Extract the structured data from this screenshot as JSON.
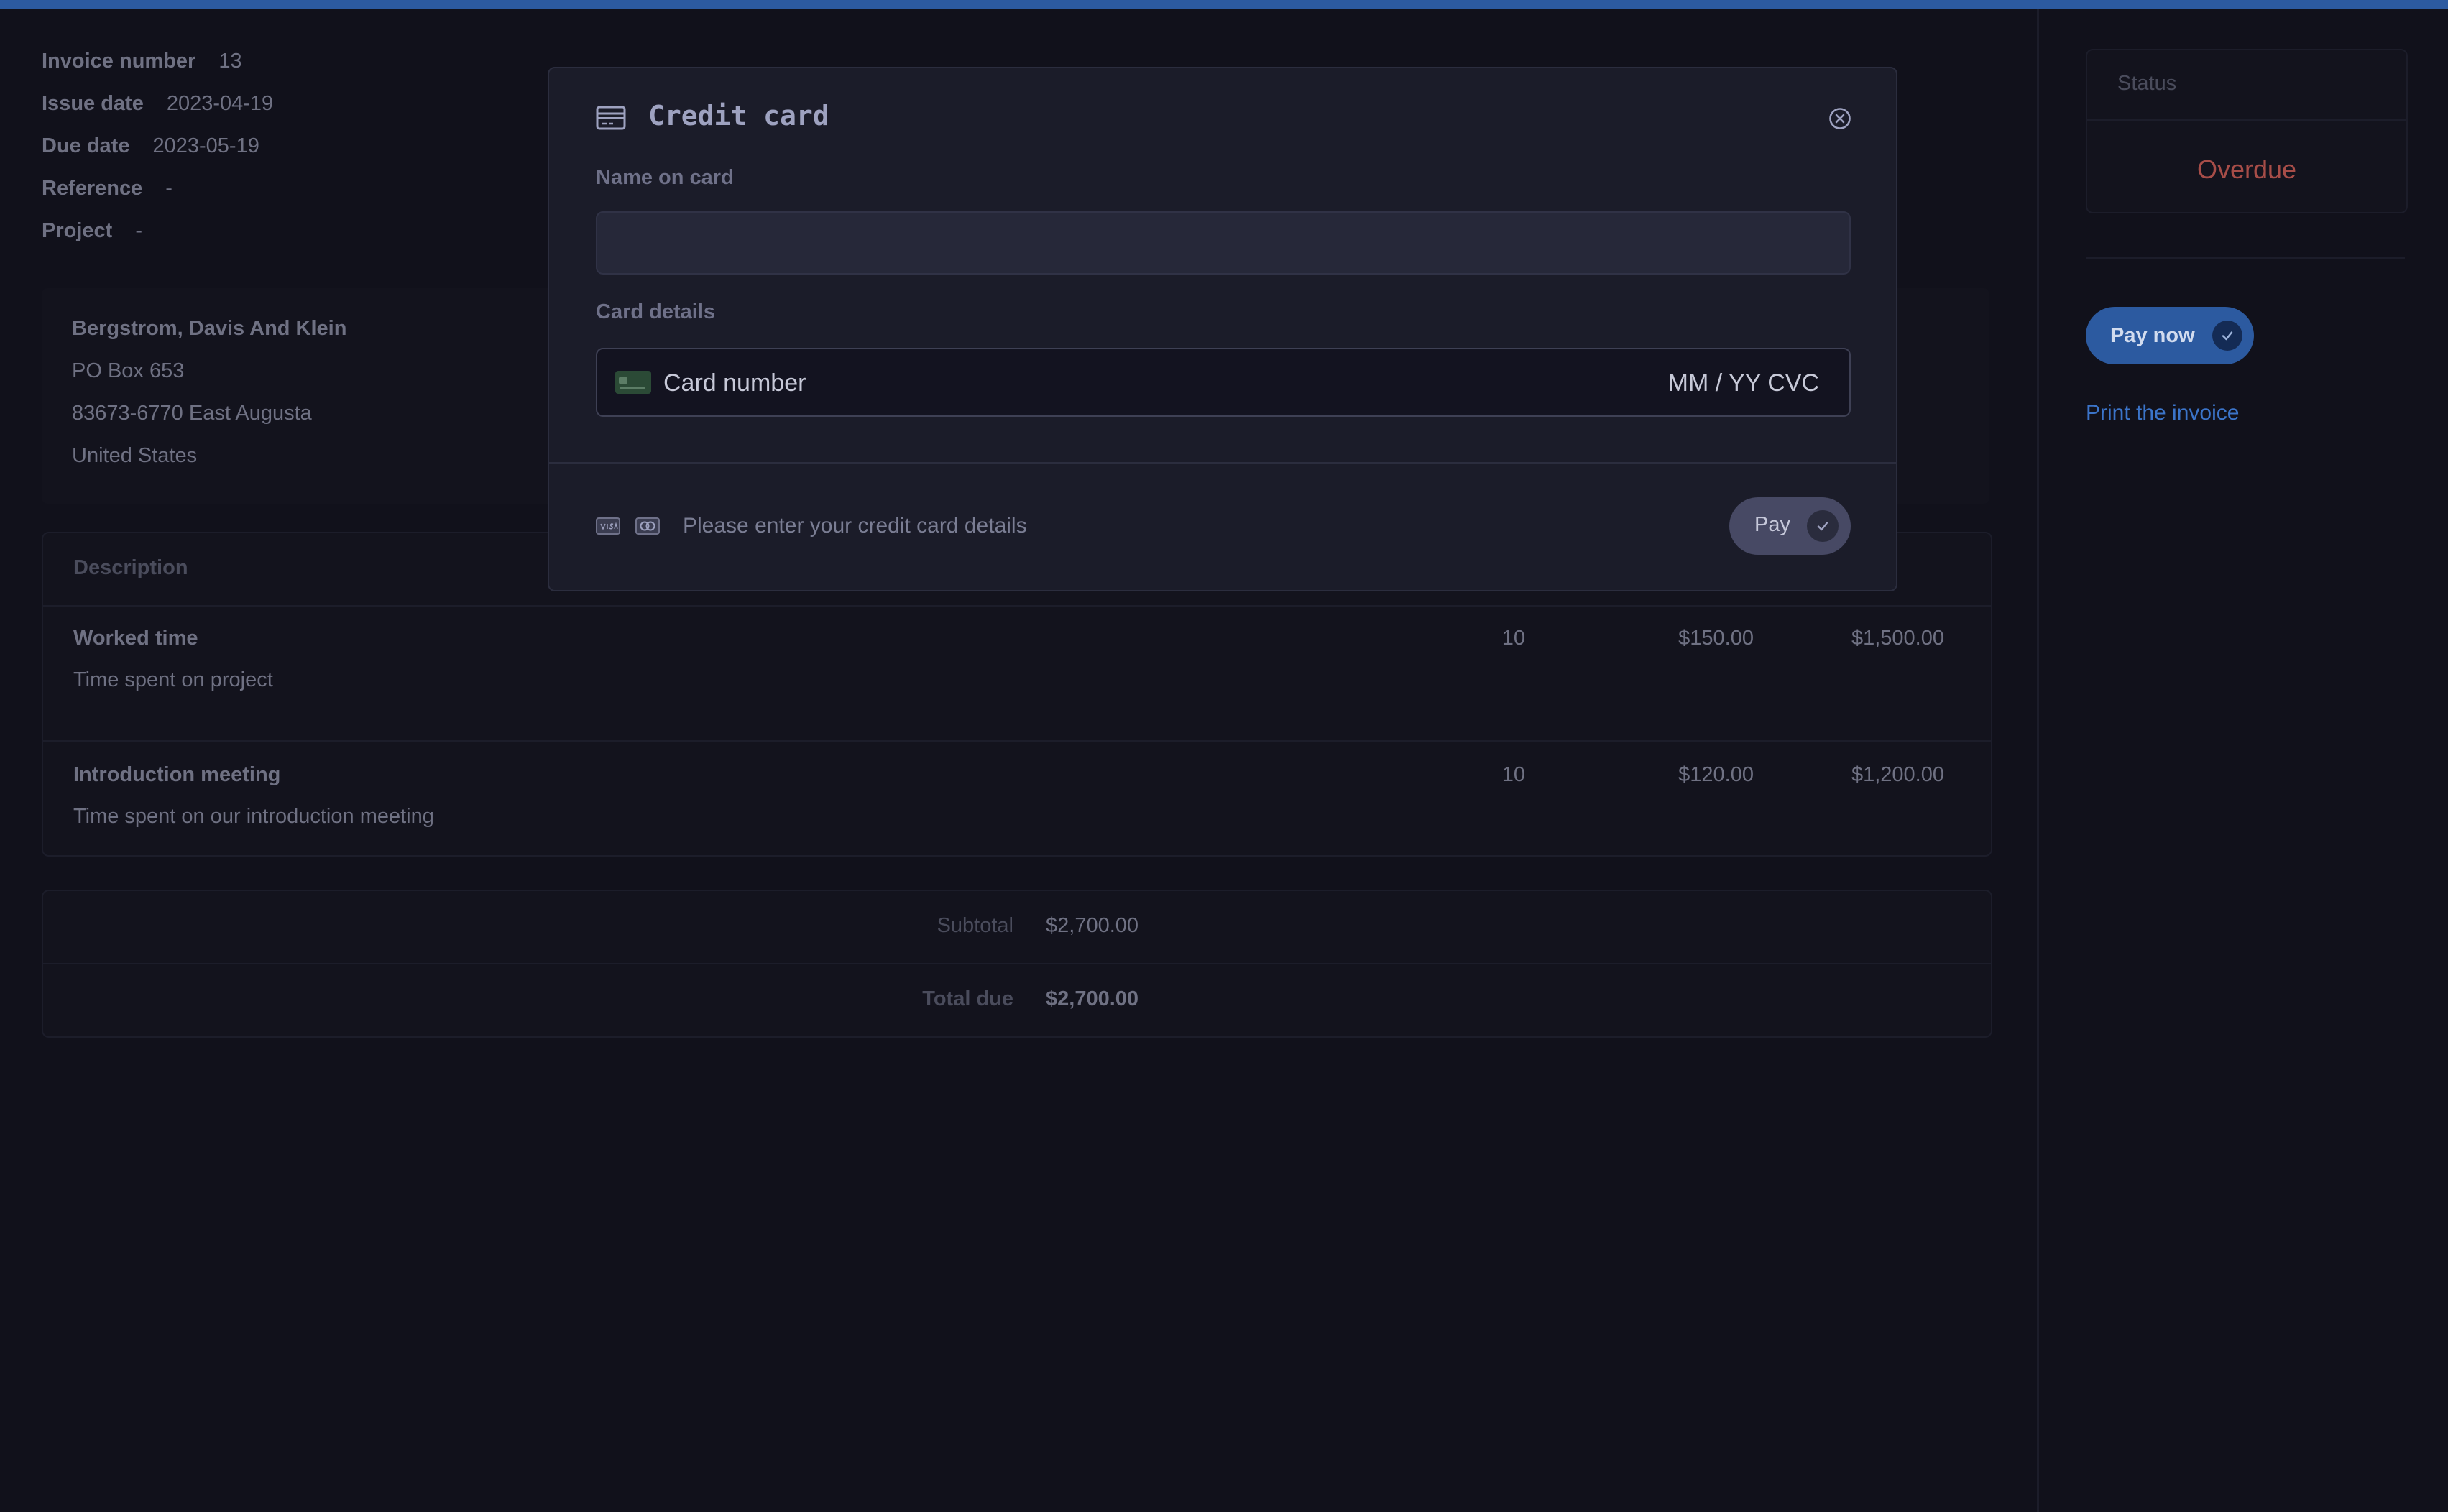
{
  "invoice_meta": [
    {
      "label": "Invoice number",
      "value": "13"
    },
    {
      "label": "Issue date",
      "value": "2023-04-19"
    },
    {
      "label": "Due date",
      "value": "2023-05-19"
    },
    {
      "label": "Reference",
      "value": "-"
    },
    {
      "label": "Project",
      "value": "-"
    }
  ],
  "address": {
    "company": "Bergstrom, Davis And Klein",
    "line1": "PO Box 653",
    "line2": "83673-6770 East Augusta",
    "country": "United States"
  },
  "items": {
    "header_description": "Description",
    "rows": [
      {
        "title": "Worked time",
        "description": "Time spent on project",
        "quantity": "10",
        "price": "$150.00",
        "total": "$1,500.00"
      },
      {
        "title": "Introduction meeting",
        "description": "Time spent on our introduction meeting",
        "quantity": "10",
        "price": "$120.00",
        "total": "$1,200.00"
      }
    ]
  },
  "totals": {
    "subtotal_label": "Subtotal",
    "subtotal_value": "$2,700.00",
    "total_label": "Total due",
    "total_value": "$2,700.00"
  },
  "sidebar": {
    "status_label": "Status",
    "status_value": "Overdue",
    "pay_now": "Pay now",
    "print": "Print the invoice"
  },
  "modal": {
    "title": "Credit card",
    "name_label": "Name on card",
    "name_value": "",
    "card_label": "Card details",
    "card_placeholder": "Card number",
    "expiry_cvc_placeholder": "MM / YY  CVC",
    "footer_message": "Please enter your credit card details",
    "pay_button": "Pay"
  },
  "colors": {
    "background": "#11111b",
    "accent": "#2c5aa0",
    "status_overdue": "#a74d48",
    "link": "#3b74c9"
  },
  "icons": [
    "credit-card-icon",
    "close-circle-icon",
    "card-brand-icon",
    "visa-icon",
    "card-icon",
    "check-icon"
  ]
}
